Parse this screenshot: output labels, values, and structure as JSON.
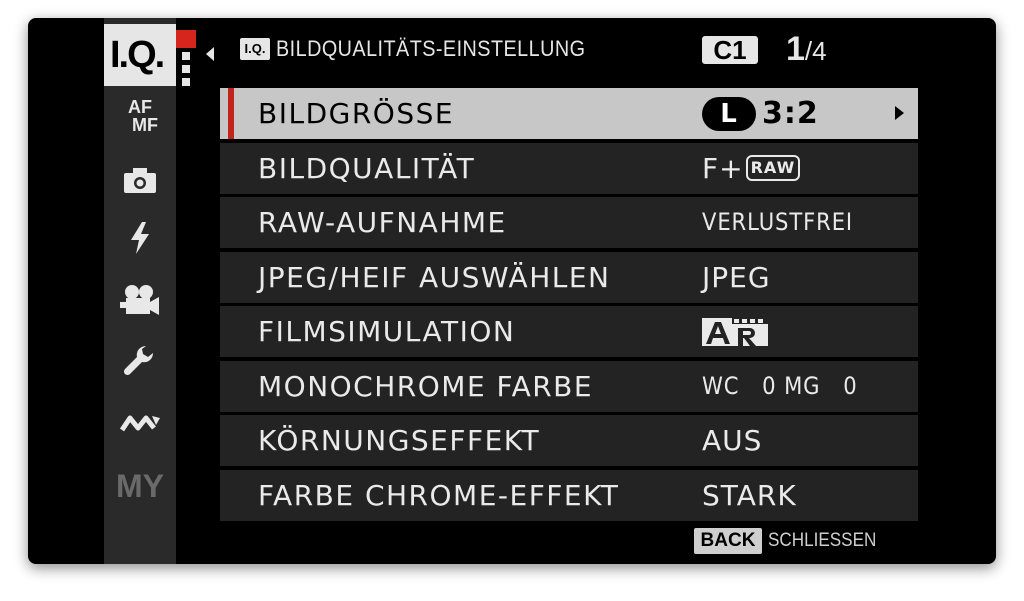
{
  "rail": {
    "logo": "I.Q.",
    "items": [
      {
        "name": "af-mf",
        "line1": "AF",
        "line2": "MF"
      },
      {
        "name": "camera-icon"
      },
      {
        "name": "flash-icon"
      },
      {
        "name": "movie-camera-icon"
      },
      {
        "name": "wrench-icon"
      },
      {
        "name": "connection-icon"
      },
      {
        "name": "my-menu",
        "label": "MY"
      }
    ]
  },
  "header": {
    "badge": "I.Q.",
    "title": "BILDQUALITÄTS-EINSTELLUNG",
    "custom_slot": "C1",
    "page_current": "1",
    "page_total": "/4"
  },
  "menu": {
    "rows": [
      {
        "label": "BILDGRÖSSE",
        "size_badge": "L",
        "ratio": "3:2"
      },
      {
        "label": "BILDQUALITÄT",
        "value": "F+",
        "raw_badge": "RAW"
      },
      {
        "label": "RAW-AUFNAHME",
        "value": "VERLUSTFREI"
      },
      {
        "label": "JPEG/HEIF AUSWÄHLEN",
        "value": "JPEG"
      },
      {
        "label": "FILMSIMULATION",
        "film_icon": "acros-red-filter-icon"
      },
      {
        "label": "MONOCHROME FARBE",
        "value": "WC   0 MG   0"
      },
      {
        "label": "KÖRNUNGSEFFEKT",
        "value": "AUS"
      },
      {
        "label": "FARBE CHROME-EFFEKT",
        "value": "STARK"
      }
    ]
  },
  "footer": {
    "back_label": "BACK",
    "back_text": "SCHLIESSEN"
  },
  "colors": {
    "selected_row": "#c7c7c7",
    "row": "#232323",
    "accent": "#c0241b"
  }
}
